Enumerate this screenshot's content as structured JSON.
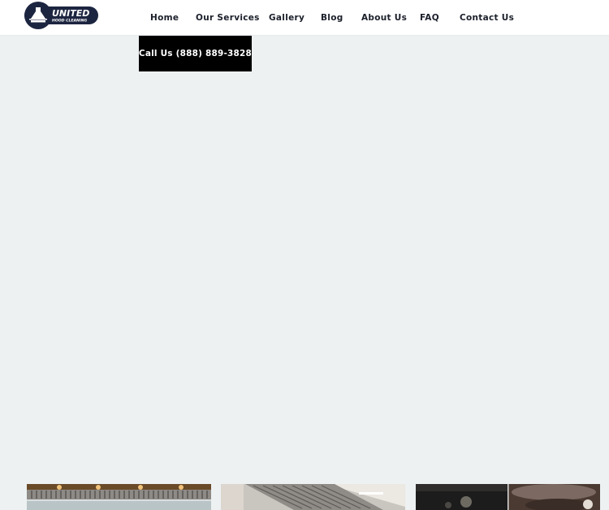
{
  "header": {
    "logo": {
      "icon": "hood-fan-icon",
      "text_line1": "UNITED",
      "text_line2": "HOOD CLEANING",
      "colors": {
        "badge": "#1c2540",
        "text": "#ffffff"
      }
    },
    "nav": [
      {
        "label": "Home"
      },
      {
        "label": "Our Services"
      },
      {
        "label": "Gallery"
      },
      {
        "label": "Blog"
      },
      {
        "label": "About Us"
      },
      {
        "label": "FAQ"
      },
      {
        "label": "Contact Us"
      }
    ]
  },
  "cta": {
    "label": "Call Us (888) 889-3828"
  },
  "colors": {
    "page_background": "#edf1f2",
    "header_background": "#ffffff",
    "nav_text": "#1b1f2a",
    "cta_background": "#000000",
    "cta_text": "#ffffff"
  },
  "gallery_thumbnails": [
    {
      "subject": "kitchen-hood-filters-photo"
    },
    {
      "subject": "stainless-hood-photo"
    },
    {
      "subject": "greasy-duct-photo"
    }
  ]
}
